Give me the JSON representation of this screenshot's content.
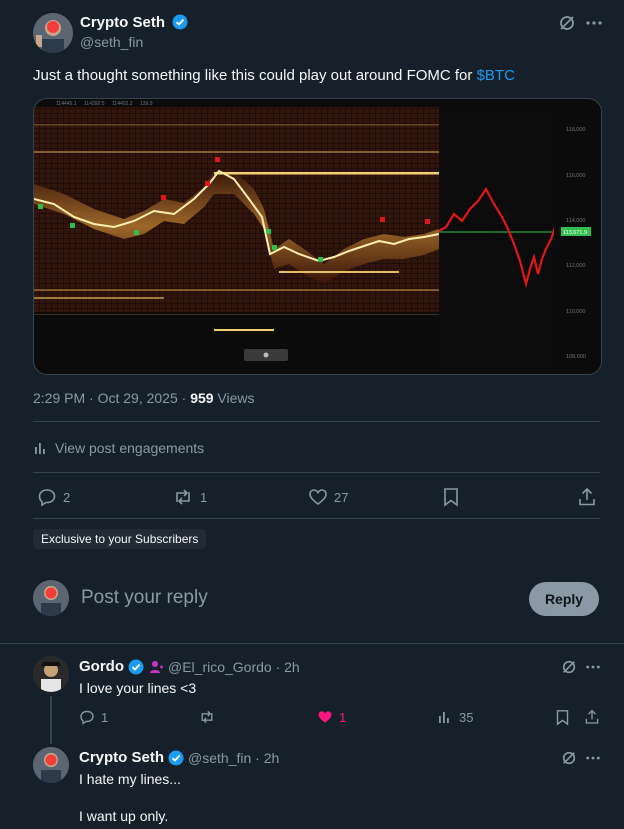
{
  "post": {
    "author_name": "Crypto Seth",
    "author_handle": "@seth_fin",
    "text_main": "Just a thought something like this could play out around FOMC for ",
    "cashtag": "$BTC",
    "time": "2:29 PM · Oct 29, 2025 · ",
    "views_count": "959",
    "views_label": " Views",
    "engagements_label": "View post engagements",
    "replies": "2",
    "reposts": "1",
    "likes": "27",
    "subscribers_badge": "Exclusive to your Subscribers"
  },
  "chart_image": {
    "price_labels": [
      "118,000",
      "116,000",
      "114,000",
      "113,671.9",
      "112,000",
      "110,000",
      "108,000"
    ],
    "header_values": [
      "114445.1",
      "114392.5",
      "114402.2",
      "139.9"
    ],
    "colors": {
      "heat": "#e0c060",
      "red_line": "#e01818",
      "green_line": "#2fbf4a"
    }
  },
  "composer": {
    "placeholder": "Post your reply",
    "reply_button": "Reply"
  },
  "replies": [
    {
      "name": "Gordo",
      "handle": "@El_rico_Gordo · 2h",
      "text": "I love your lines <3",
      "replies": "1",
      "likes": "1",
      "views": "35"
    },
    {
      "name": "Crypto Seth",
      "handle": "@seth_fin · 2h",
      "text_line1": "I hate my lines...",
      "text_line2": "I want up only."
    }
  ]
}
